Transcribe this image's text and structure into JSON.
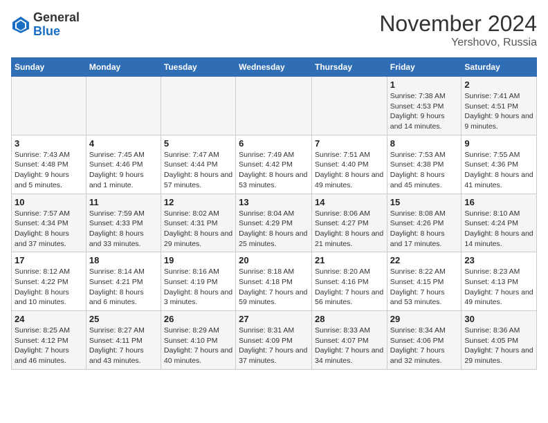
{
  "logo": {
    "general": "General",
    "blue": "Blue"
  },
  "title": "November 2024",
  "subtitle": "Yershovo, Russia",
  "days_of_week": [
    "Sunday",
    "Monday",
    "Tuesday",
    "Wednesday",
    "Thursday",
    "Friday",
    "Saturday"
  ],
  "weeks": [
    [
      {
        "day": "",
        "info": ""
      },
      {
        "day": "",
        "info": ""
      },
      {
        "day": "",
        "info": ""
      },
      {
        "day": "",
        "info": ""
      },
      {
        "day": "",
        "info": ""
      },
      {
        "day": "1",
        "info": "Sunrise: 7:38 AM\nSunset: 4:53 PM\nDaylight: 9 hours and 14 minutes."
      },
      {
        "day": "2",
        "info": "Sunrise: 7:41 AM\nSunset: 4:51 PM\nDaylight: 9 hours and 9 minutes."
      }
    ],
    [
      {
        "day": "3",
        "info": "Sunrise: 7:43 AM\nSunset: 4:48 PM\nDaylight: 9 hours and 5 minutes."
      },
      {
        "day": "4",
        "info": "Sunrise: 7:45 AM\nSunset: 4:46 PM\nDaylight: 9 hours and 1 minute."
      },
      {
        "day": "5",
        "info": "Sunrise: 7:47 AM\nSunset: 4:44 PM\nDaylight: 8 hours and 57 minutes."
      },
      {
        "day": "6",
        "info": "Sunrise: 7:49 AM\nSunset: 4:42 PM\nDaylight: 8 hours and 53 minutes."
      },
      {
        "day": "7",
        "info": "Sunrise: 7:51 AM\nSunset: 4:40 PM\nDaylight: 8 hours and 49 minutes."
      },
      {
        "day": "8",
        "info": "Sunrise: 7:53 AM\nSunset: 4:38 PM\nDaylight: 8 hours and 45 minutes."
      },
      {
        "day": "9",
        "info": "Sunrise: 7:55 AM\nSunset: 4:36 PM\nDaylight: 8 hours and 41 minutes."
      }
    ],
    [
      {
        "day": "10",
        "info": "Sunrise: 7:57 AM\nSunset: 4:34 PM\nDaylight: 8 hours and 37 minutes."
      },
      {
        "day": "11",
        "info": "Sunrise: 7:59 AM\nSunset: 4:33 PM\nDaylight: 8 hours and 33 minutes."
      },
      {
        "day": "12",
        "info": "Sunrise: 8:02 AM\nSunset: 4:31 PM\nDaylight: 8 hours and 29 minutes."
      },
      {
        "day": "13",
        "info": "Sunrise: 8:04 AM\nSunset: 4:29 PM\nDaylight: 8 hours and 25 minutes."
      },
      {
        "day": "14",
        "info": "Sunrise: 8:06 AM\nSunset: 4:27 PM\nDaylight: 8 hours and 21 minutes."
      },
      {
        "day": "15",
        "info": "Sunrise: 8:08 AM\nSunset: 4:26 PM\nDaylight: 8 hours and 17 minutes."
      },
      {
        "day": "16",
        "info": "Sunrise: 8:10 AM\nSunset: 4:24 PM\nDaylight: 8 hours and 14 minutes."
      }
    ],
    [
      {
        "day": "17",
        "info": "Sunrise: 8:12 AM\nSunset: 4:22 PM\nDaylight: 8 hours and 10 minutes."
      },
      {
        "day": "18",
        "info": "Sunrise: 8:14 AM\nSunset: 4:21 PM\nDaylight: 8 hours and 6 minutes."
      },
      {
        "day": "19",
        "info": "Sunrise: 8:16 AM\nSunset: 4:19 PM\nDaylight: 8 hours and 3 minutes."
      },
      {
        "day": "20",
        "info": "Sunrise: 8:18 AM\nSunset: 4:18 PM\nDaylight: 7 hours and 59 minutes."
      },
      {
        "day": "21",
        "info": "Sunrise: 8:20 AM\nSunset: 4:16 PM\nDaylight: 7 hours and 56 minutes."
      },
      {
        "day": "22",
        "info": "Sunrise: 8:22 AM\nSunset: 4:15 PM\nDaylight: 7 hours and 53 minutes."
      },
      {
        "day": "23",
        "info": "Sunrise: 8:23 AM\nSunset: 4:13 PM\nDaylight: 7 hours and 49 minutes."
      }
    ],
    [
      {
        "day": "24",
        "info": "Sunrise: 8:25 AM\nSunset: 4:12 PM\nDaylight: 7 hours and 46 minutes."
      },
      {
        "day": "25",
        "info": "Sunrise: 8:27 AM\nSunset: 4:11 PM\nDaylight: 7 hours and 43 minutes."
      },
      {
        "day": "26",
        "info": "Sunrise: 8:29 AM\nSunset: 4:10 PM\nDaylight: 7 hours and 40 minutes."
      },
      {
        "day": "27",
        "info": "Sunrise: 8:31 AM\nSunset: 4:09 PM\nDaylight: 7 hours and 37 minutes."
      },
      {
        "day": "28",
        "info": "Sunrise: 8:33 AM\nSunset: 4:07 PM\nDaylight: 7 hours and 34 minutes."
      },
      {
        "day": "29",
        "info": "Sunrise: 8:34 AM\nSunset: 4:06 PM\nDaylight: 7 hours and 32 minutes."
      },
      {
        "day": "30",
        "info": "Sunrise: 8:36 AM\nSunset: 4:05 PM\nDaylight: 7 hours and 29 minutes."
      }
    ]
  ]
}
